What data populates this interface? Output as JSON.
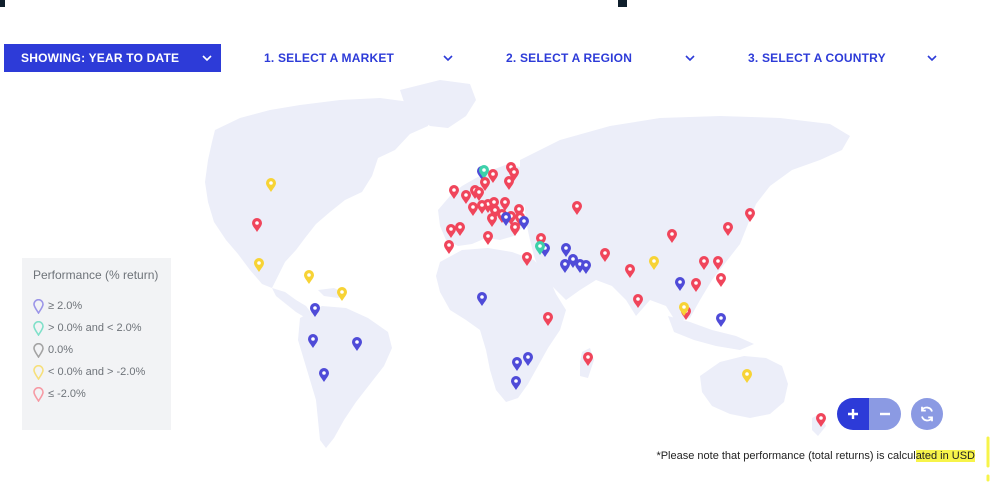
{
  "filters": {
    "period_label": "SHOWING: YEAR TO DATE",
    "market_label": "1. SELECT A MARKET",
    "region_label": "2. SELECT A REGION",
    "country_label": "3. SELECT A COUNTRY"
  },
  "legend": {
    "title": "Performance (% return)",
    "items": [
      {
        "label": "≥ 2.0%",
        "color": "#9b95e8",
        "category": "strong-positive"
      },
      {
        "label": "> 0.0% and < 2.0%",
        "color": "#7fe0c9",
        "category": "positive"
      },
      {
        "label": "0.0%",
        "color": "#a3a3a3",
        "category": "flat"
      },
      {
        "label": "< 0.0% and > -2.0%",
        "color": "#f6df7a",
        "category": "negative"
      },
      {
        "label": "≤ -2.0%",
        "color": "#f69aa4",
        "category": "strong-negative"
      }
    ]
  },
  "map": {
    "land_color": "#eceef9",
    "pin_colors": {
      "strong-positive": "#4f4bd8",
      "positive": "#3dd1aa",
      "flat": "#8f8f8f",
      "negative": "#f7d335",
      "strong-negative": "#f0455b"
    }
  },
  "controls": {
    "zoom_in_icon": "plus-icon",
    "zoom_out_icon": "minus-icon",
    "reset_icon": "refresh-icon"
  },
  "footnote": {
    "prefix": "*",
    "text": "Please note that performance (total returns) is calcul",
    "highlighted": "ated in USD"
  }
}
